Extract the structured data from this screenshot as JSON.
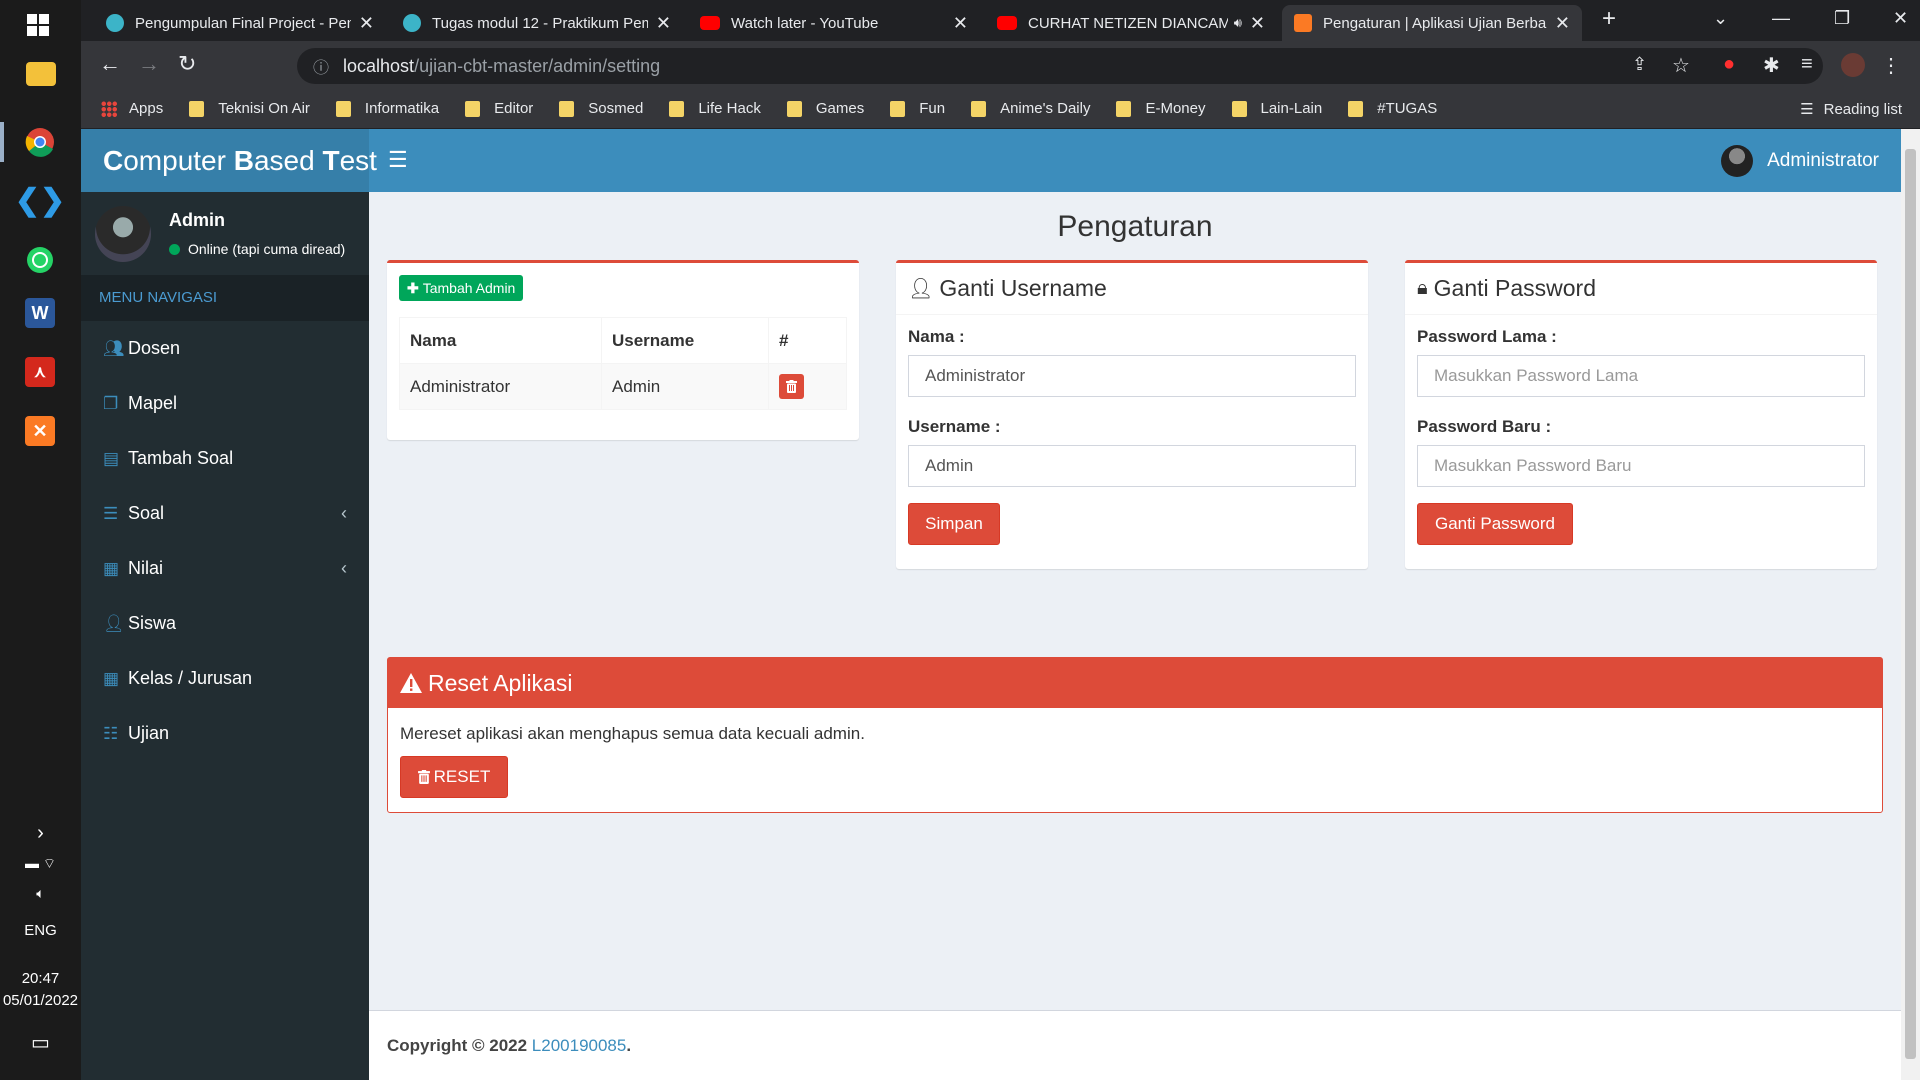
{
  "taskbar": {
    "lang": "ENG",
    "time": "20:47",
    "date": "05/01/2022"
  },
  "browser": {
    "tabs": [
      {
        "title": "Pengumpulan Final Project - Pem",
        "color": "#3cb4c8"
      },
      {
        "title": "Tugas modul 12 - Praktikum Pem",
        "color": "#3cb4c8"
      },
      {
        "title": "Watch later - YouTube",
        "color": "#ff0000"
      },
      {
        "title": "CURHAT NETIZEN DIANCAM",
        "color": "#ff0000"
      },
      {
        "title": "Pengaturan | Aplikasi Ujian Berba",
        "color": "#fb7a24"
      }
    ],
    "url_host": "localhost",
    "url_path": "/ujian-cbt-master/admin/setting",
    "bookmarks": [
      "Apps",
      "Teknisi On Air",
      "Informatika",
      "Editor",
      "Sosmed",
      "Life Hack",
      "Games",
      "Fun",
      "Anime's Daily",
      "E-Money",
      "Lain-Lain",
      "#TUGAS"
    ],
    "reading_list": "Reading list"
  },
  "header": {
    "logo_c": "C",
    "logo_rest1": "omputer ",
    "logo_b": "B",
    "logo_rest2": "ased ",
    "logo_t": "T",
    "logo_rest3": "est",
    "user": "Administrator"
  },
  "sidebar": {
    "user_name": "Admin",
    "user_status": "Online (tapi cuma diread)",
    "menu_header": "MENU NAVIGASI",
    "items": [
      {
        "label": "Dosen",
        "icon": "users-icon"
      },
      {
        "label": "Mapel",
        "icon": "copy-icon"
      },
      {
        "label": "Tambah Soal",
        "icon": "list-alt-icon"
      },
      {
        "label": "Soal",
        "icon": "list-icon"
      },
      {
        "label": "Nilai",
        "icon": "table-icon"
      },
      {
        "label": "Siswa",
        "icon": "user-icon"
      },
      {
        "label": "Kelas / Jurusan",
        "icon": "th-icon"
      },
      {
        "label": "Ujian",
        "icon": "th-list-icon"
      }
    ]
  },
  "main": {
    "title": "Pengaturan",
    "admin_box": {
      "add_button": "Tambah Admin",
      "columns": [
        "Nama",
        "Username",
        "#"
      ],
      "rows": [
        [
          "Administrator",
          "Admin"
        ]
      ]
    },
    "username_box": {
      "title": "Ganti Username",
      "nama_label": "Nama :",
      "nama_value": "Administrator",
      "username_label": "Username :",
      "username_value": "Admin",
      "save_button": "Simpan"
    },
    "password_box": {
      "title": "Ganti Password",
      "old_label": "Password Lama :",
      "old_placeholder": "Masukkan Password Lama",
      "new_label": "Password Baru :",
      "new_placeholder": "Masukkan Password Baru",
      "button": "Ganti Password"
    },
    "reset_box": {
      "title": "Reset Aplikasi",
      "text": "Mereset aplikasi akan menghapus semua data kecuali admin.",
      "button": "RESET"
    }
  },
  "footer": {
    "text": "Copyright © 2022 ",
    "link": "L200190085",
    "suffix": "."
  },
  "colors": {
    "primary": "#3c8dbc",
    "danger": "#dd4b39",
    "success": "#00a65a",
    "sidebar": "#222d32"
  }
}
